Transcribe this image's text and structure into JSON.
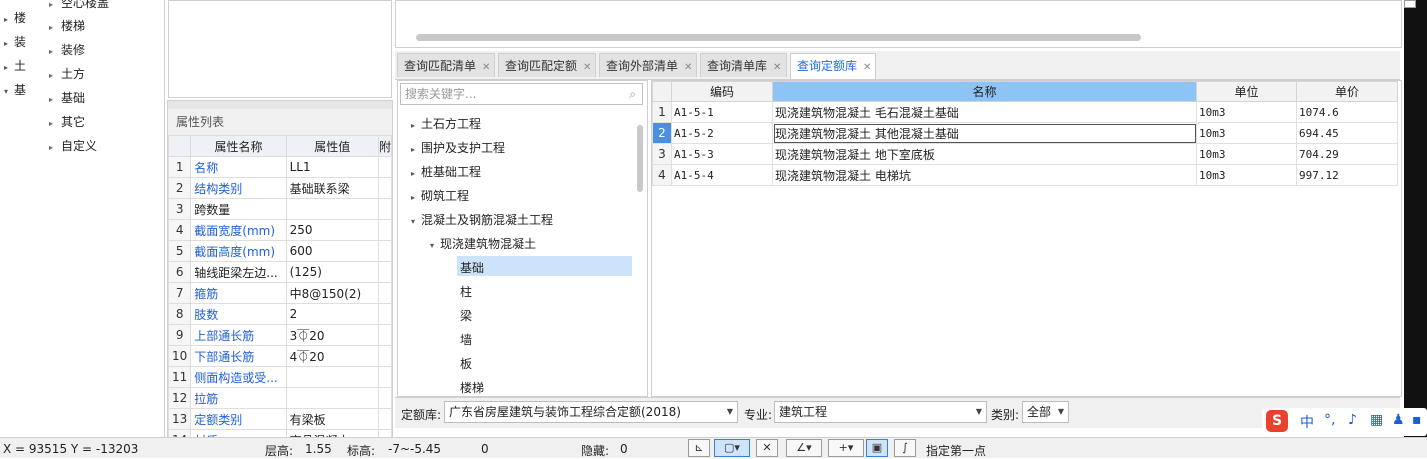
{
  "left_strip": {
    "items": [
      {
        "label": "楼",
        "expanded": false
      },
      {
        "label": "装",
        "expanded": false
      },
      {
        "label": "土",
        "expanded": false
      },
      {
        "label": "基",
        "expanded": true
      }
    ]
  },
  "category_tree": {
    "items": [
      {
        "label": "空心楼盖"
      },
      {
        "label": "楼梯"
      },
      {
        "label": "装修"
      },
      {
        "label": "土方"
      },
      {
        "label": "基础"
      },
      {
        "label": "其它"
      },
      {
        "label": "自定义"
      }
    ]
  },
  "property_panel": {
    "title": "属性列表",
    "col_name": "属性名称",
    "col_value": "属性值",
    "col_extra": "附",
    "rows": [
      {
        "n": "1",
        "name": "名称",
        "value": "LL1",
        "blue": true
      },
      {
        "n": "2",
        "name": "结构类别",
        "value": "基础联系梁",
        "blue": true
      },
      {
        "n": "3",
        "name": "跨数量",
        "value": "",
        "blue": false
      },
      {
        "n": "4",
        "name": "截面宽度(mm)",
        "value": "250",
        "blue": true
      },
      {
        "n": "5",
        "name": "截面高度(mm)",
        "value": "600",
        "blue": true
      },
      {
        "n": "6",
        "name": "轴线距梁左边...",
        "value": "(125)",
        "blue": false
      },
      {
        "n": "7",
        "name": "箍筋",
        "value": "中8@150(2)",
        "blue": true
      },
      {
        "n": "8",
        "name": "肢数",
        "value": "2",
        "blue": true
      },
      {
        "n": "9",
        "name": "上部通长筋",
        "value": "3⏁20",
        "blue": true
      },
      {
        "n": "10",
        "name": "下部通长筋",
        "value": "4⏁20",
        "blue": true
      },
      {
        "n": "11",
        "name": "侧面构造或受...",
        "value": "",
        "blue": true
      },
      {
        "n": "12",
        "name": "拉筋",
        "value": "",
        "blue": true
      },
      {
        "n": "13",
        "name": "定额类别",
        "value": "有梁板",
        "blue": true
      },
      {
        "n": "14",
        "name": "材质",
        "value": "商品混凝土",
        "blue": true
      }
    ]
  },
  "tabs": [
    {
      "label": "查询匹配清单",
      "active": false
    },
    {
      "label": "查询匹配定额",
      "active": false
    },
    {
      "label": "查询外部清单",
      "active": false
    },
    {
      "label": "查询清单库",
      "active": false
    },
    {
      "label": "查询定额库",
      "active": true
    }
  ],
  "query_tree": {
    "search_placeholder": "搜索关键字...",
    "items": [
      {
        "label": "土石方工程",
        "level": 0,
        "tri": "▸"
      },
      {
        "label": "围护及支护工程",
        "level": 0,
        "tri": "▸"
      },
      {
        "label": "桩基础工程",
        "level": 0,
        "tri": "▸"
      },
      {
        "label": "砌筑工程",
        "level": 0,
        "tri": "▸"
      },
      {
        "label": "混凝土及钢筋混凝土工程",
        "level": 0,
        "tri": "▾"
      },
      {
        "label": "现浇建筑物混凝土",
        "level": 1,
        "tri": "▾"
      },
      {
        "label": "基础",
        "level": 2,
        "tri": ""
      },
      {
        "label": "柱",
        "level": 2,
        "tri": ""
      },
      {
        "label": "梁",
        "level": 2,
        "tri": ""
      },
      {
        "label": "墙",
        "level": 2,
        "tri": ""
      },
      {
        "label": "板",
        "level": 2,
        "tri": ""
      },
      {
        "label": "楼梯",
        "level": 2,
        "tri": ""
      }
    ],
    "selected": "基础"
  },
  "grid": {
    "headers": {
      "code": "编码",
      "name": "名称",
      "unit": "单位",
      "price": "单价"
    },
    "rows": [
      {
        "n": "1",
        "code": "A1-5-1",
        "name": "现浇建筑物混凝土 毛石混凝土基础",
        "unit": "10m3",
        "price": "1074.6"
      },
      {
        "n": "2",
        "code": "A1-5-2",
        "name": "现浇建筑物混凝土 其他混凝土基础",
        "unit": "10m3",
        "price": "694.45"
      },
      {
        "n": "3",
        "code": "A1-5-3",
        "name": "现浇建筑物混凝土 地下室底板",
        "unit": "10m3",
        "price": "704.29"
      },
      {
        "n": "4",
        "code": "A1-5-4",
        "name": "现浇建筑物混凝土 电梯坑",
        "unit": "10m3",
        "price": "997.12"
      }
    ],
    "selected_row": "2"
  },
  "selectors": {
    "quota_label": "定额库:",
    "quota_value": "广东省房屋建筑与装饰工程综合定额(2018)",
    "major_label": "专业:",
    "major_value": "建筑工程",
    "category_label": "类别:",
    "category_value": "全部"
  },
  "status_bar": {
    "coords": "X = 93515 Y = -13203",
    "floor_label": "层高:",
    "floor_value": "1.55",
    "elev_label": "标高:",
    "elev_value": "-7~-5.45",
    "zero": "0",
    "hidden_label": "隐藏:",
    "hidden_value": "0",
    "hint": "指定第一点"
  },
  "ime": {
    "logo": "S",
    "lang": "中"
  }
}
